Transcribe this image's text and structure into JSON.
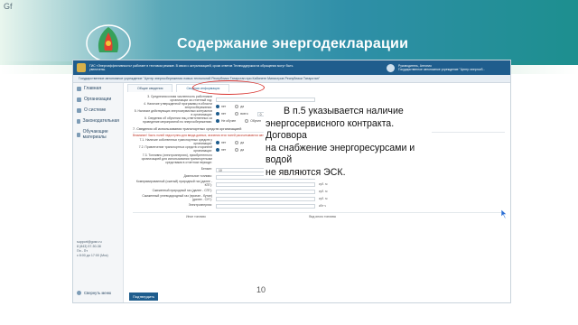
{
  "slide": {
    "title": "Содержание энергодекларации",
    "page_number": "10",
    "corner_mark": "Gf"
  },
  "colors": {
    "header": "#2f8fa8",
    "accent": "#1f5d8d",
    "highlight": "#d8332f"
  },
  "app": {
    "system_title": "ГИС «Энергоэффективность» работает в тестовом режиме. В связи с актуализацией, сроки ответов Технподдержки на обращения могут быть увеличены.",
    "user_name": "Руководитель, Антонио",
    "user_org": "Государственное автономное учреждение \"Центр энергосб...",
    "org_line": "Государственное автономное учреждение \"Центр энергосбережения новых технологий Республики Татарстан при Кабинете Министров Республики Татарстан\"",
    "sidebar": {
      "items": [
        {
          "label": "Главная",
          "icon": "home-icon"
        },
        {
          "label": "Организации",
          "icon": "building-icon"
        },
        {
          "label": "О системе",
          "icon": "info-icon"
        },
        {
          "label": "Законодательная",
          "icon": "book-icon"
        },
        {
          "label": "Обучающие материалы",
          "icon": "graduation-icon"
        }
      ],
      "contacts": [
        "support@gosn.ru",
        "8 (843) 57-50-38",
        "Пн - Пт",
        "с 8:00 до 17:00 (Мск)"
      ],
      "collapse_label": "Свернуть меню"
    },
    "tabs": [
      {
        "label": "Общие сведения",
        "active": false
      },
      {
        "label": "Сводная информация",
        "active": true
      }
    ],
    "form": {
      "rows_top": [
        {
          "label": "3. Среднесписочная численность работников организации за отчетный год:",
          "value": ""
        },
        {
          "label": "4. Наличие утвержденной программы в области энергосбережения:",
          "radio": [
            "нет",
            "да"
          ],
          "selected": "нет"
        },
        {
          "label": "5. Наличие действующих энергосервисных контрактов в организации:",
          "radio": [
            "нет",
            "всего"
          ],
          "selected": "нет",
          "count": "0"
        },
        {
          "label": "6. Сведения об обучении лиц ответственных за проведение мероприятий по энергосбережению:",
          "radio": [
            "Не обучен",
            "Обучен"
          ],
          "selected": "Не обучен"
        }
      ],
      "section7_title": "7. Сведения об использовании транспортных средств организацией",
      "section7_warning": "Внимание! Часть полей недоступны для ввода данных, значения этих полей рассчитываются автоматически на основе исходных данных.",
      "rows_transport": [
        {
          "label": "7.1. Наличие собственных транспортных средств у организации:",
          "radio": [
            "нет",
            "да"
          ],
          "selected": "нет"
        },
        {
          "label": "7.2. Привлечение транспортных средств сторонней организации:",
          "radio": [
            "нет",
            "да"
          ],
          "selected": "нет"
        },
        {
          "label": "7.3. Топливно (электроэнергию), приобретенного организацией для использования транспортными средствами в отчетном периоде:",
          "value": "",
          "unit": ""
        }
      ],
      "rows_fuel": [
        {
          "label": "Бензин:",
          "value": "10",
          "unit": "л"
        },
        {
          "label": "Дизельное топливо:",
          "value": "",
          "unit": "л"
        },
        {
          "label": "Компримированный (сжатый) природный газ (далее - КПГ):",
          "value": "",
          "unit": "куб. м"
        },
        {
          "label": "Сжиженный природный газ (далее - СПГ):",
          "value": "",
          "unit": "куб. м"
        },
        {
          "label": "Сжиженный углеводородный газ (пропан - бутан) (далее - СУГ):",
          "value": "",
          "unit": "куб. м"
        },
        {
          "label": "Электроэнергия:",
          "value": "",
          "unit": "кВт·ч"
        }
      ],
      "table_head": [
        "Иное топливо",
        "Вид иного топлива"
      ],
      "save_label": "Подтвердить"
    }
  },
  "annotation": {
    "lines": [
      "В п.5 указывается наличие",
      "энергосервисного контракта. Договора",
      "на снабжение энергоресурсами и водой",
      "не являются ЭСК."
    ]
  }
}
